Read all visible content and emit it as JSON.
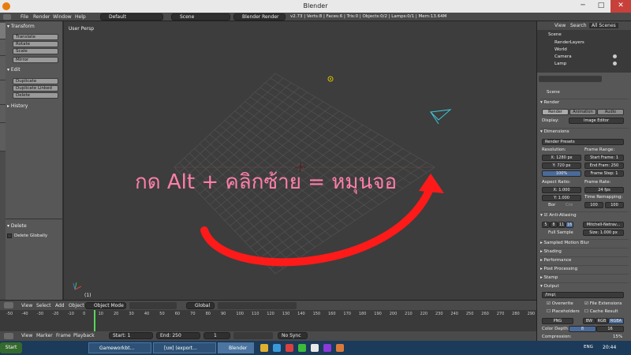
{
  "window": {
    "title": "Blender",
    "minimize": "─",
    "maximize": "□",
    "close": "✕"
  },
  "infobar": {
    "menus": [
      "File",
      "Render",
      "Window",
      "Help"
    ],
    "layout": "Default",
    "scene": "Scene",
    "engine": "Blender Render",
    "stats": "v2.73 | Verts:8 | Faces:6 | Tris:0 | Objects:0/2 | Lamps:0/1 | Mem:13.64M"
  },
  "toolshelf": {
    "tabs": [
      "Tools",
      "Create",
      "Relations",
      "Animation",
      "Physics",
      "Grease Pencil"
    ],
    "transform_header": "Transform",
    "transform_buttons": [
      "Translate",
      "Rotate",
      "Scale",
      "Mirror"
    ],
    "edit_header": "Edit",
    "edit_buttons": [
      "Duplicate",
      "Duplicate Linked",
      "Delete"
    ],
    "history_header": "History",
    "operator_header": "Delete",
    "operator_option": "Delete Globally"
  },
  "viewport": {
    "label": "User Persp",
    "annotation": "กด Alt + คลิกซ้าย = หมุนจอ",
    "object_count_label": "(1)",
    "colors": {
      "grid": "#555555",
      "arrow": "#ff1a1a",
      "annotation": "#ff7fa8"
    }
  },
  "viewport_header": {
    "menus": [
      "View",
      "Select",
      "Add",
      "Object"
    ],
    "mode": "Object Mode",
    "pivot": "Global"
  },
  "timeline": {
    "ticks": [
      "-50",
      "-40",
      "-30",
      "-20",
      "-10",
      "0",
      "10",
      "20",
      "30",
      "40",
      "50",
      "60",
      "70",
      "80",
      "90",
      "100",
      "110",
      "120",
      "130",
      "140",
      "150",
      "160",
      "170",
      "180",
      "190",
      "200",
      "210",
      "220",
      "230",
      "240",
      "250",
      "260",
      "270",
      "280",
      "290"
    ],
    "current": "1",
    "menus": [
      "View",
      "Marker",
      "Frame",
      "Playback"
    ],
    "start_label": "Start:",
    "start": "1",
    "end_label": "End:",
    "end": "250",
    "frame": "1",
    "sync": "No Sync"
  },
  "outliner": {
    "menus": [
      "View",
      "Search",
      "All Scenes"
    ],
    "items": [
      "Scene",
      "RenderLayers",
      "World",
      "Camera",
      "Lamp"
    ]
  },
  "properties": {
    "context": "Scene",
    "render_header": "Render",
    "render_buttons": [
      "Render",
      "Animation",
      "Audio"
    ],
    "display_label": "Display:",
    "display_value": "Image Editor",
    "dimensions_header": "Dimensions",
    "presets": "Render Presets",
    "resolution_label": "Resolution:",
    "res_x": "X:",
    "res_x_val": "1280 px",
    "res_y": "Y:",
    "res_y_val": "720 px",
    "res_pct": "100%",
    "frame_range_label": "Frame Range:",
    "start_frame": "Start Frame:",
    "start_frame_val": "1",
    "end_frame": "End Fram: 250",
    "frame_step": "Frame Step: 1",
    "aspect_label": "Aspect Ratio:",
    "asp_x": "X:",
    "asp_x_val": "1.000",
    "asp_y": "Y:",
    "asp_y_val": "1.000",
    "frame_rate_label": "Frame Rate:",
    "fps": "24 fps",
    "time_remap": "Time Remapping:",
    "remap_old": "100",
    "remap_new": "100",
    "border": "Bor",
    "crop": "Cro",
    "aa_header": "Anti-Aliasing",
    "aa_samples": [
      "5",
      "8",
      "11",
      "16"
    ],
    "aa_filter": "Mitchell-Netrav...",
    "full_sample": "Full Sample",
    "aa_size": "Size: 1.000 px",
    "sections": [
      "Sampled Motion Blur",
      "Shading",
      "Performance",
      "Post Processing",
      "Stamp",
      "Output"
    ],
    "output_path": "/tmp\\",
    "overwrite": "Overwrite",
    "file_ext": "File Extensions",
    "placeholders": "Placeholders",
    "cache_result": "Cache Result",
    "format": "PNG",
    "color_modes": [
      "BW",
      "RGB",
      "RGBA"
    ],
    "color_depth_label": "Color Depth:",
    "color_depth": [
      "8",
      "16"
    ],
    "compression": "Compression:",
    "compression_val": "15%"
  },
  "taskbar": {
    "start": "Start",
    "tasks": [
      "Gameworkbt...",
      "[บท] (export...",
      "Blender"
    ],
    "lang": "ENG",
    "time": "20:44"
  }
}
